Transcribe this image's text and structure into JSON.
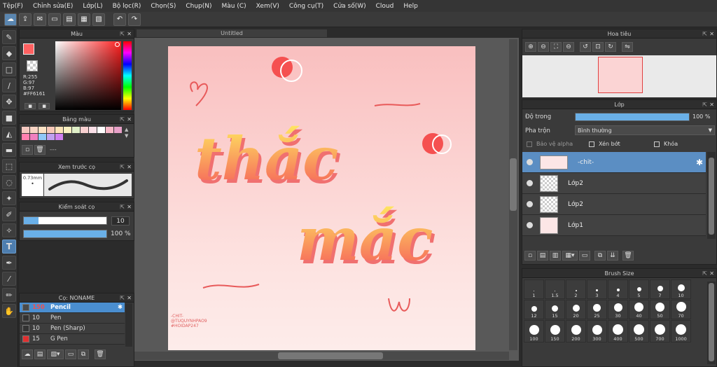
{
  "menu": [
    "Tệp(F)",
    "Chỉnh sửa(E)",
    "Lớp(L)",
    "Bộ lọc(R)",
    "Chọn(S)",
    "Chụp(N)",
    "Màu (C)",
    "Xem(V)",
    "Công cụ(T)",
    "Cửa số(W)",
    "Cloud",
    "Help"
  ],
  "color_panel": {
    "title": "Màu",
    "r": "R:255",
    "g": "G:97",
    "b": "B:97",
    "hex": "#FF6161",
    "primary": "#ff6161"
  },
  "palette_panel": {
    "title": "Bảng màu",
    "dashes": "---"
  },
  "preview_panel": {
    "title": "Xem trước cọ",
    "size": "0.73mm"
  },
  "control_panel": {
    "title": "Kiểm soát cọ",
    "size_value": "10",
    "opacity_value": "100 %"
  },
  "brush_panel": {
    "title": "Cọ: NONAME",
    "brushes": [
      {
        "size": "150",
        "name": "Pencil",
        "color": "#4a4a4a"
      },
      {
        "size": "10",
        "name": "Pen",
        "color": "#333"
      },
      {
        "size": "10",
        "name": "Pen (Sharp)",
        "color": "#333"
      },
      {
        "size": "15",
        "name": "G Pen",
        "color": "#e03030"
      }
    ]
  },
  "document": {
    "tab": "Untitled"
  },
  "artwork": {
    "line1": "thắc",
    "line2": "mắc",
    "signature1": "-CHIT-",
    "signature2": "@TUQUYNHPAO9",
    "signature3": "#HOIDAP247"
  },
  "navigator": {
    "title": "Hoa tiêu"
  },
  "layer_panel": {
    "title": "Lớp",
    "opacity_label": "Độ trong",
    "opacity_value": "100 %",
    "blend_label": "Pha trộn",
    "blend_value": "Bình thường",
    "protect_alpha": "Bảo vệ alpha",
    "clipping": "Xén bớt",
    "lock": "Khóa",
    "layers": [
      {
        "name": "-chit-"
      },
      {
        "name": "Lớp2"
      },
      {
        "name": "Lớp2"
      },
      {
        "name": "Lớp1"
      }
    ]
  },
  "brushsize_panel": {
    "title": "Brush Size",
    "sizes": [
      "1",
      "1.5",
      "2",
      "3",
      "4",
      "5",
      "7",
      "10",
      "12",
      "15",
      "20",
      "25",
      "30",
      "40",
      "50",
      "70",
      "100",
      "150",
      "200",
      "300",
      "400",
      "500",
      "700",
      "1000"
    ]
  }
}
